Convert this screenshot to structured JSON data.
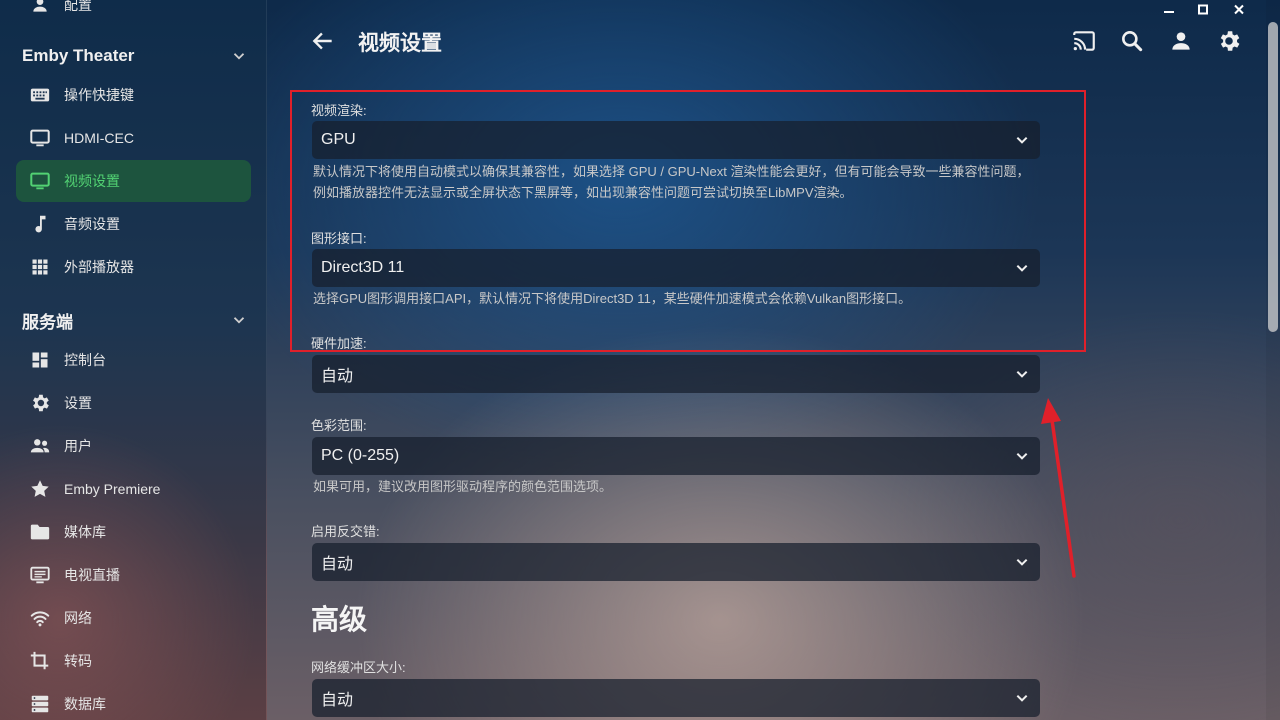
{
  "window": {
    "controls": {
      "minimize": "minimize-icon",
      "maximize": "maximize-icon",
      "close": "close-icon"
    }
  },
  "sidebar": {
    "top_partial_item": {
      "label": "配置",
      "icon": "person-icon"
    },
    "sections": [
      {
        "title": "Emby Theater",
        "items": [
          {
            "label": "操作快捷键",
            "icon": "keyboard-icon"
          },
          {
            "label": "HDMI-CEC",
            "icon": "monitor-icon"
          },
          {
            "label": "视频设置",
            "icon": "monitor-icon",
            "active": true
          },
          {
            "label": "音频设置",
            "icon": "music-note-icon"
          },
          {
            "label": "外部播放器",
            "icon": "grid-icon"
          }
        ]
      },
      {
        "title": "服务端",
        "items": [
          {
            "label": "控制台",
            "icon": "dashboard-icon"
          },
          {
            "label": "设置",
            "icon": "gear-icon"
          },
          {
            "label": "用户",
            "icon": "people-icon"
          },
          {
            "label": "Emby Premiere",
            "icon": "star-icon"
          },
          {
            "label": "媒体库",
            "icon": "folder-icon"
          },
          {
            "label": "电视直播",
            "icon": "tv-icon"
          },
          {
            "label": "网络",
            "icon": "wifi-icon"
          },
          {
            "label": "转码",
            "icon": "crop-icon"
          },
          {
            "label": "数据库",
            "icon": "database-icon"
          }
        ]
      }
    ]
  },
  "header": {
    "title": "视频设置",
    "back_icon": "arrow-left-icon",
    "actions": [
      "cast-icon",
      "search-icon",
      "user-icon",
      "gear-icon"
    ]
  },
  "form": {
    "fields": [
      {
        "label": "视频渲染:",
        "value": "GPU",
        "help": "默认情况下将使用自动模式以确保其兼容性，如果选择 GPU / GPU-Next 渲染性能会更好，但有可能会导致一些兼容性问题，例如播放器控件无法显示或全屏状态下黑屏等，如出现兼容性问题可尝试切换至LibMPV渲染。"
      },
      {
        "label": "图形接口:",
        "value": "Direct3D 11",
        "help": "选择GPU图形调用接口API，默认情况下将使用Direct3D 11，某些硬件加速模式会依赖Vulkan图形接口。"
      },
      {
        "label": "硬件加速:",
        "value": "自动",
        "help": ""
      },
      {
        "label": "色彩范围:",
        "value": "PC (0-255)",
        "help": "如果可用，建议改用图形驱动程序的颜色范围选项。"
      },
      {
        "label": "启用反交错:",
        "value": "自动",
        "help": ""
      }
    ],
    "advanced": {
      "title": "高级",
      "fields": [
        {
          "label": "网络缓冲区大小:",
          "value": "自动"
        }
      ]
    }
  },
  "annotation": {
    "highlight_color": "#e0202a"
  },
  "colors": {
    "active_bg": "#1e5a3c",
    "active_text": "#52d273"
  }
}
